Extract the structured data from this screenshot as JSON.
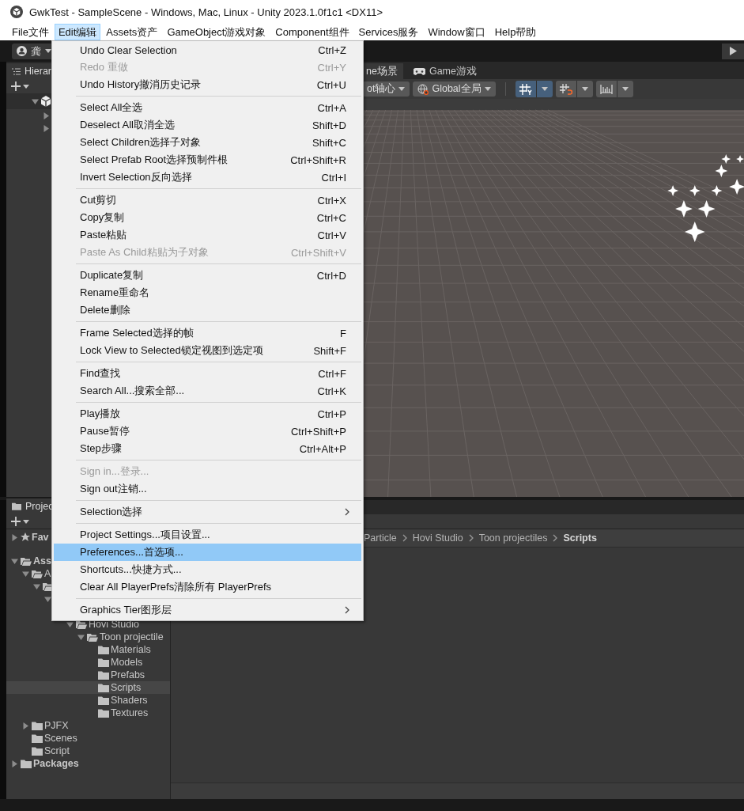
{
  "window": {
    "title": "GwkTest - SampleScene - Windows, Mac, Linux - Unity 2023.1.0f1c1 <DX11>"
  },
  "menubar": [
    {
      "label": "File文件",
      "selected": false
    },
    {
      "label": "Edit编辑",
      "selected": true
    },
    {
      "label": "Assets资产",
      "selected": false
    },
    {
      "label": "GameObject游戏对象",
      "selected": false
    },
    {
      "label": "Component组件",
      "selected": false
    },
    {
      "label": "Services服务",
      "selected": false
    },
    {
      "label": "Window窗口",
      "selected": false
    },
    {
      "label": "Help帮助",
      "selected": false
    }
  ],
  "toolbar": {
    "account": "龚"
  },
  "hierarchy": {
    "tab": "Hierar",
    "rows": [
      {
        "expanded": true,
        "children": [
          {
            "expanded": false
          },
          {
            "expanded": false
          }
        ]
      }
    ]
  },
  "scene": {
    "tabs": [
      {
        "label": "ne场景",
        "selected": true,
        "kind": "scene"
      },
      {
        "label": "Game游戏",
        "selected": false,
        "kind": "game"
      }
    ],
    "pivot": "ot轴心",
    "global": "Global全局",
    "tools": [
      {
        "kind": "grid",
        "on": true
      },
      {
        "kind": "snap",
        "on": false
      },
      {
        "kind": "increment",
        "on": false
      }
    ]
  },
  "project": {
    "tab": "Projec",
    "favorites": {
      "label": "Fav",
      "expanded": false,
      "selected": false
    },
    "tree": [
      {
        "label": "Ass",
        "expanded": true,
        "selected": false,
        "children": [
          {
            "label": "A",
            "expanded": true,
            "selected": false,
            "children": [
              {
                "expanded": true,
                "selected": false,
                "children": [
                  {
                    "expanded": true,
                    "selected": false,
                    "children": [
                      {
                        "selected": false,
                        "children": [
                          {
                            "label": "Hovi Studio",
                            "expanded": true,
                            "selected": false,
                            "children": [
                              {
                                "label": "Toon projectile",
                                "expanded": true,
                                "selected": false,
                                "children": [
                                  {
                                    "label": "Materials",
                                    "selected": false
                                  },
                                  {
                                    "label": "Models",
                                    "selected": false
                                  },
                                  {
                                    "label": "Prefabs",
                                    "selected": false
                                  },
                                  {
                                    "label": "Scripts",
                                    "selected": true
                                  },
                                  {
                                    "label": "Shaders",
                                    "selected": false
                                  },
                                  {
                                    "label": "Textures",
                                    "selected": false
                                  }
                                ]
                              }
                            ]
                          }
                        ]
                      }
                    ]
                  }
                ]
              }
            ]
          },
          {
            "label": "PJFX",
            "expanded": false,
            "selected": false
          },
          {
            "label": "Scenes",
            "selected": false
          },
          {
            "label": "Script",
            "selected": false
          }
        ]
      },
      {
        "label": "Packages",
        "expanded": false,
        "selected": false
      }
    ],
    "breadcrumbs": [
      {
        "label": "Particle",
        "current": false
      },
      {
        "label": "Hovi Studio",
        "current": false
      },
      {
        "label": "Toon projectiles",
        "current": false
      },
      {
        "label": "Scripts",
        "current": true
      }
    ]
  },
  "edit_menu": {
    "groups": [
      {
        "items": [
          {
            "label": "Undo Clear Selection",
            "shortcut": "Ctrl+Z",
            "disabled": false,
            "selected": false,
            "submenu": false
          },
          {
            "label": "Redo 重做",
            "shortcut": "Ctrl+Y",
            "disabled": true,
            "selected": false,
            "submenu": false
          },
          {
            "label": "Undo History撤消历史记录",
            "shortcut": "Ctrl+U",
            "disabled": false,
            "selected": false,
            "submenu": false
          }
        ]
      },
      {
        "items": [
          {
            "label": "Select All全选",
            "shortcut": "Ctrl+A",
            "disabled": false,
            "selected": false,
            "submenu": false
          },
          {
            "label": "Deselect All取消全选",
            "shortcut": "Shift+D",
            "disabled": false,
            "selected": false,
            "submenu": false
          },
          {
            "label": "Select Children选择子对象",
            "shortcut": "Shift+C",
            "disabled": false,
            "selected": false,
            "submenu": false
          },
          {
            "label": "Select Prefab Root选择预制件根",
            "shortcut": "Ctrl+Shift+R",
            "disabled": false,
            "selected": false,
            "submenu": false
          },
          {
            "label": "Invert Selection反向选择",
            "shortcut": "Ctrl+I",
            "disabled": false,
            "selected": false,
            "submenu": false
          }
        ]
      },
      {
        "items": [
          {
            "label": "Cut剪切",
            "shortcut": "Ctrl+X",
            "disabled": false,
            "selected": false,
            "submenu": false
          },
          {
            "label": "Copy复制",
            "shortcut": "Ctrl+C",
            "disabled": false,
            "selected": false,
            "submenu": false
          },
          {
            "label": "Paste粘贴",
            "shortcut": "Ctrl+V",
            "disabled": false,
            "selected": false,
            "submenu": false
          },
          {
            "label": "Paste As Child粘贴为子对象",
            "shortcut": "Ctrl+Shift+V",
            "disabled": true,
            "selected": false,
            "submenu": false
          }
        ]
      },
      {
        "items": [
          {
            "label": "Duplicate复制",
            "shortcut": "Ctrl+D",
            "disabled": false,
            "selected": false,
            "submenu": false
          },
          {
            "label": "Rename重命名",
            "disabled": false,
            "selected": false,
            "submenu": false
          },
          {
            "label": "Delete删除",
            "disabled": false,
            "selected": false,
            "submenu": false
          }
        ]
      },
      {
        "items": [
          {
            "label": "Frame Selected选择的帧",
            "shortcut": "F",
            "disabled": false,
            "selected": false,
            "submenu": false
          },
          {
            "label": "Lock View to Selected锁定视图到选定项",
            "shortcut": "Shift+F",
            "disabled": false,
            "selected": false,
            "submenu": false
          }
        ]
      },
      {
        "items": [
          {
            "label": "Find查找",
            "shortcut": "Ctrl+F",
            "disabled": false,
            "selected": false,
            "submenu": false
          },
          {
            "label": "Search All...搜索全部...",
            "shortcut": "Ctrl+K",
            "disabled": false,
            "selected": false,
            "submenu": false
          }
        ]
      },
      {
        "items": [
          {
            "label": "Play播放",
            "shortcut": "Ctrl+P",
            "disabled": false,
            "selected": false,
            "submenu": false
          },
          {
            "label": "Pause暂停",
            "shortcut": "Ctrl+Shift+P",
            "disabled": false,
            "selected": false,
            "submenu": false
          },
          {
            "label": "Step步骤",
            "shortcut": "Ctrl+Alt+P",
            "disabled": false,
            "selected": false,
            "submenu": false
          }
        ]
      },
      {
        "items": [
          {
            "label": "Sign in...登录...",
            "disabled": true,
            "selected": false,
            "submenu": false
          },
          {
            "label": "Sign out注销...",
            "disabled": false,
            "selected": false,
            "submenu": false
          }
        ]
      },
      {
        "items": [
          {
            "label": "Selection选择",
            "disabled": false,
            "selected": false,
            "submenu": true
          }
        ]
      },
      {
        "items": [
          {
            "label": "Project Settings...项目设置...",
            "disabled": false,
            "selected": false,
            "submenu": false
          },
          {
            "label": "Preferences...首选项...",
            "disabled": false,
            "selected": true,
            "submenu": false
          },
          {
            "label": "Shortcuts...快捷方式...",
            "disabled": false,
            "selected": false,
            "submenu": false
          },
          {
            "label": "Clear All PlayerPrefs清除所有 PlayerPrefs",
            "disabled": false,
            "selected": false,
            "submenu": false
          }
        ]
      },
      {
        "items": [
          {
            "label": "Graphics Tier图形层",
            "disabled": false,
            "selected": false,
            "submenu": true
          }
        ]
      }
    ]
  }
}
